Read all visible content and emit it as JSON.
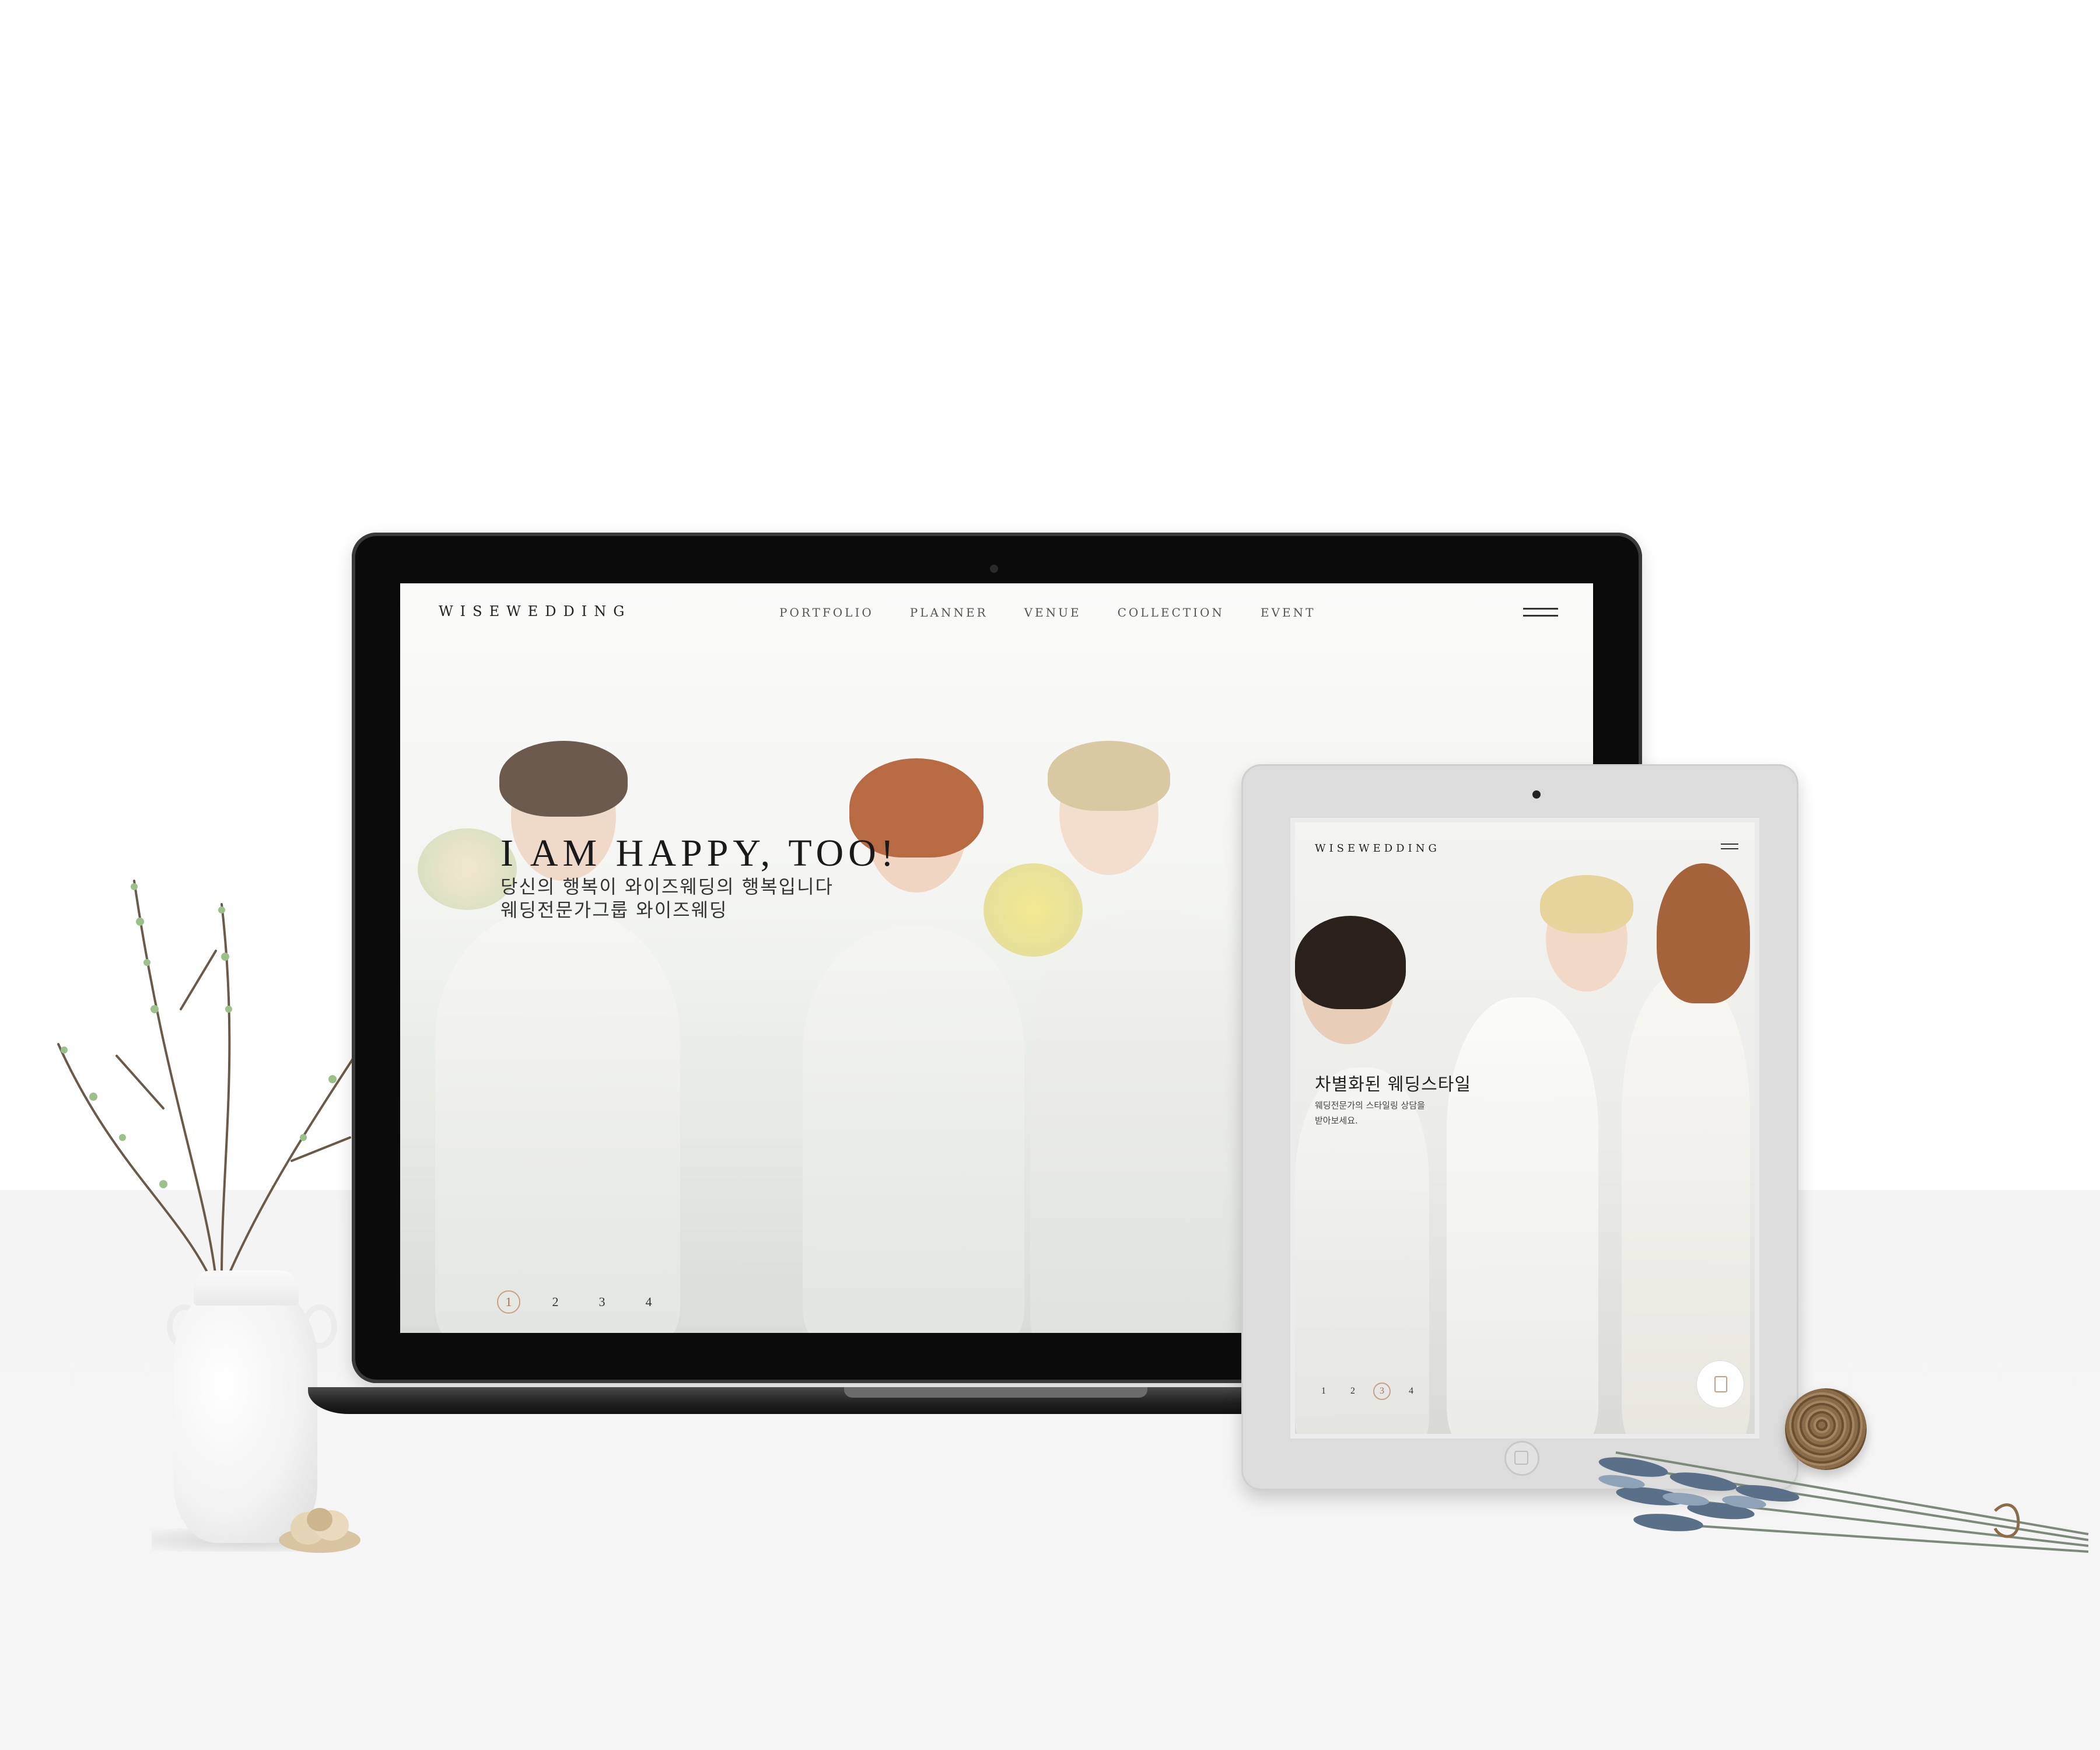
{
  "laptop": {
    "site": {
      "logo": "WISEWEDDING",
      "nav": [
        "PORTFOLIO",
        "PLANNER",
        "VENUE",
        "COLLECTION",
        "EVENT"
      ],
      "hero": {
        "title": "I AM HAPPY, TOO!",
        "subtitle_line1": "당신의 행복이 와이즈웨딩의 행복입니다",
        "subtitle_line2": "웨딩전문가그룹 와이즈웨딩"
      },
      "pager": [
        "1",
        "2",
        "3",
        "4"
      ],
      "pager_active": "1"
    }
  },
  "tablet": {
    "site": {
      "logo": "WISEWEDDING",
      "hero": {
        "title": "차별화된 웨딩스타일",
        "subtitle_line1": "웨딩전문가의 스타일링 상담을",
        "subtitle_line2": "받아보세요."
      },
      "pager": [
        "1",
        "2",
        "3",
        "4"
      ],
      "pager_active": "3"
    }
  },
  "colors": {
    "accent": "#c79f86",
    "text": "#1a1a1a",
    "background": "#ffffff",
    "device_dark": "#0b0b0b",
    "device_light": "#dcdcdc"
  },
  "icons": {
    "menu": "hamburger-icon",
    "badge": "contact-badge-icon",
    "home_button": "home-button-icon"
  }
}
